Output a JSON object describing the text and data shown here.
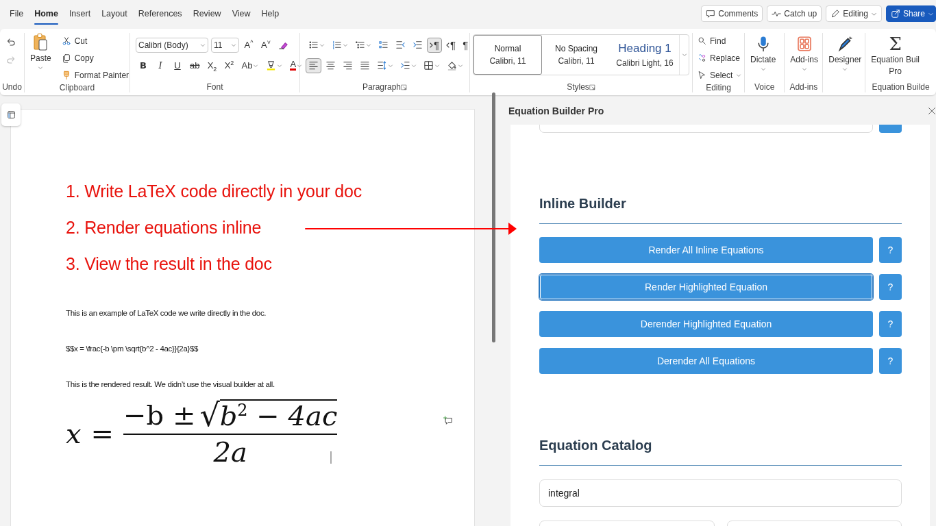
{
  "menu_tabs": [
    {
      "label": "File",
      "selected": false
    },
    {
      "label": "Home",
      "selected": true
    },
    {
      "label": "Insert",
      "selected": false
    },
    {
      "label": "Layout",
      "selected": false
    },
    {
      "label": "References",
      "selected": false
    },
    {
      "label": "Review",
      "selected": false
    },
    {
      "label": "View",
      "selected": false
    },
    {
      "label": "Help",
      "selected": false
    }
  ],
  "header_buttons": [
    {
      "kind": "comments",
      "label": "Comments"
    },
    {
      "kind": "catch_up",
      "label": "Catch up"
    },
    {
      "kind": "editing",
      "label": "Editing"
    },
    {
      "kind": "share",
      "label": "Share"
    }
  ],
  "ribbon": {
    "undo": {
      "redo_disabled": true,
      "label": "Undo"
    },
    "clipboard": {
      "paste": "Paste",
      "items": [
        {
          "kind": "cut",
          "label": "Cut"
        },
        {
          "kind": "copy",
          "label": "Copy"
        },
        {
          "kind": "format_painter",
          "label": "Format Painter"
        }
      ],
      "label": "Clipboard"
    },
    "font": {
      "font_name": "Calibri (Body)",
      "font_size": "11",
      "size_tools": [
        {
          "kind": "grow",
          "label": "A$^{^}$"
        },
        {
          "kind": "shrink",
          "label": "A$^{˅}$"
        },
        {
          "kind": "clear"
        }
      ],
      "format_tools": [
        {
          "kind": "bold",
          "label": "B"
        },
        {
          "kind": "italic",
          "label": "I"
        },
        {
          "kind": "underline",
          "label": "U"
        },
        {
          "kind": "strike",
          "label": "ab"
        },
        {
          "kind": "subscript",
          "label": "X$_{2}$"
        },
        {
          "kind": "superscript",
          "label": "X$^{2}$"
        },
        {
          "kind": "case",
          "label": "Ab"
        },
        {
          "kind": "highlight"
        },
        {
          "kind": "font_color",
          "label": "A"
        }
      ],
      "label": "Font"
    },
    "paragraph": {
      "rows": [
        [
          {
            "kind": "bullets",
            "selected": false
          },
          {
            "kind": "numbering",
            "selected": false
          },
          {
            "kind": "multilevel",
            "selected": false
          },
          {
            "kind": "checklist",
            "selected": false
          },
          {
            "kind": "outdent",
            "selected": false
          },
          {
            "kind": "indent",
            "selected": false
          },
          {
            "kind": "ltr",
            "glyph": "¶",
            "selected": true
          },
          {
            "kind": "rtl",
            "glyph": "¶",
            "selected": false
          },
          {
            "kind": "show_marks",
            "glyph": "¶",
            "selected": false
          }
        ],
        [
          {
            "kind": "align_left",
            "selected": true
          },
          {
            "kind": "align_center",
            "selected": false
          },
          {
            "kind": "align_right",
            "selected": false
          },
          {
            "kind": "justify",
            "selected": false
          },
          {
            "kind": "line_spacing",
            "selected": false
          },
          {
            "kind": "list_indent",
            "selected": false
          },
          {
            "kind": "borders",
            "selected": false
          },
          {
            "kind": "shading",
            "selected": false
          }
        ]
      ],
      "label": "Paragraph"
    },
    "styles": {
      "items": [
        {
          "kind": "body",
          "name": "Normal",
          "font": "Calibri, 11",
          "selected": true
        },
        {
          "kind": "body",
          "name": "No Spacing",
          "font": "Calibri, 11",
          "selected": false
        },
        {
          "kind": "heading",
          "name": "Heading 1",
          "font": "Calibri Light, 16",
          "selected": false
        }
      ],
      "label": "Styles"
    },
    "editing": {
      "items": [
        {
          "kind": "find",
          "label": "Find"
        },
        {
          "kind": "replace",
          "label": "Replace"
        },
        {
          "kind": "select",
          "label": "Select"
        }
      ],
      "label": "Editing"
    },
    "large_buttons": [
      {
        "kind": "dictate",
        "label": [
          "Dictate"
        ],
        "group": "Voice"
      },
      {
        "kind": "add_ins",
        "label": [
          "Add-ins"
        ],
        "group": "Add-ins"
      },
      {
        "kind": "designer",
        "label": [
          "Designer"
        ]
      },
      {
        "kind": "equation",
        "glyph": "Σ",
        "label": [
          "Equation Buil",
          "Pro"
        ],
        "group": "Equation Builde"
      }
    ]
  },
  "document": {
    "steps": [
      "1. Write LaTeX code directly in your doc",
      "2. Render equations inline",
      "3. View the result in the doc"
    ],
    "paragraphs": [
      "This is an example of LaTeX code we write directly in the doc.",
      "$$x = \\frac{-b \\pm \\sqrt{b^2 - 4ac}}{2a}$$",
      "This is the rendered result. We didn’t use the visual builder at all."
    ],
    "equation": {
      "lhs": "x",
      "relation": "=",
      "numerator": "−b ±",
      "radical": "√",
      "radicand": "b$^{2}$ − 4ac",
      "denominator": "2a"
    }
  },
  "pane": {
    "title": "Equation Builder Pro",
    "inline_builder": {
      "heading": "Inline Builder",
      "buttons": [
        {
          "label": "Render All Inline Equations",
          "help": "?",
          "selected": false
        },
        {
          "label": "Render Highlighted Equation",
          "help": "?",
          "selected": true
        },
        {
          "label": "Derender Highlighted Equation",
          "help": "?",
          "selected": false
        },
        {
          "label": "Derender All Equations",
          "help": "?",
          "selected": false
        }
      ]
    },
    "equation_catalog": {
      "heading": "Equation Catalog",
      "search": {
        "value": "integral"
      }
    }
  }
}
